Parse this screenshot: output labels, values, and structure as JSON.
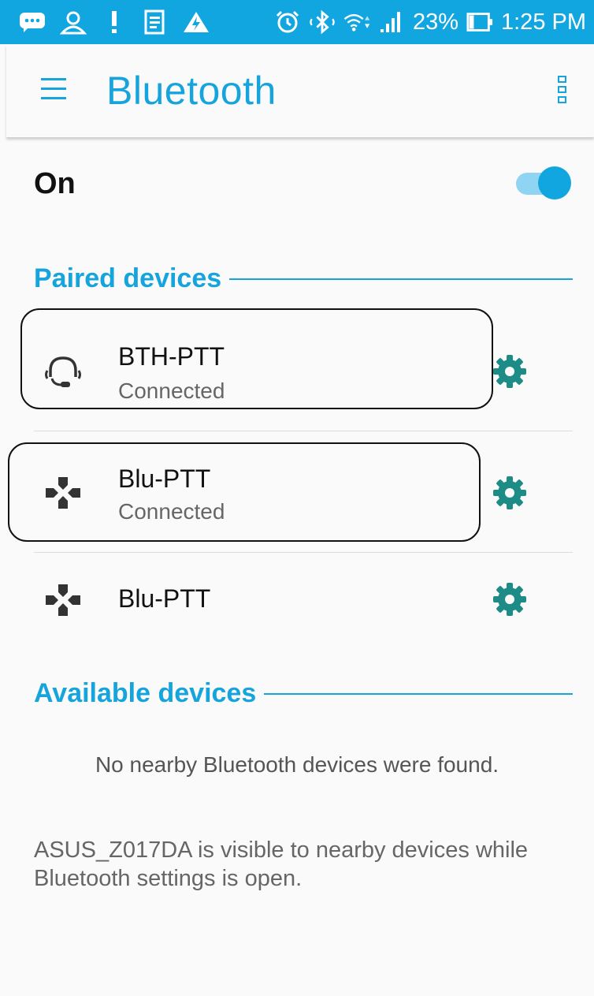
{
  "status_bar": {
    "icons": [
      "messaging-icon",
      "contacts-icon",
      "alert-icon",
      "notes-icon",
      "power-saver-icon",
      "alarm-icon",
      "bluetooth-icon",
      "wifi-icon",
      "signal-icon",
      "battery-icon"
    ],
    "battery": "23%",
    "time": "1:25 PM"
  },
  "header": {
    "title": "Bluetooth"
  },
  "toggle": {
    "label": "On",
    "state": true
  },
  "paired": {
    "header": "Paired devices",
    "devices": [
      {
        "name": "BTH-PTT",
        "status": "Connected",
        "icon": "headset-icon"
      },
      {
        "name": "Blu-PTT",
        "status": "Connected",
        "icon": "gamepad-icon"
      },
      {
        "name": "Blu-PTT",
        "status": "",
        "icon": "gamepad-icon"
      }
    ]
  },
  "available": {
    "header": "Available devices",
    "empty_message": "No nearby Bluetooth devices were found."
  },
  "footer": {
    "visibility_note": "ASUS_Z017DA is visible to nearby devices while Bluetooth settings is open."
  },
  "colors": {
    "accent": "#16a4dc",
    "status_bar": "#12a6e0",
    "gear": "#1e8c86"
  }
}
